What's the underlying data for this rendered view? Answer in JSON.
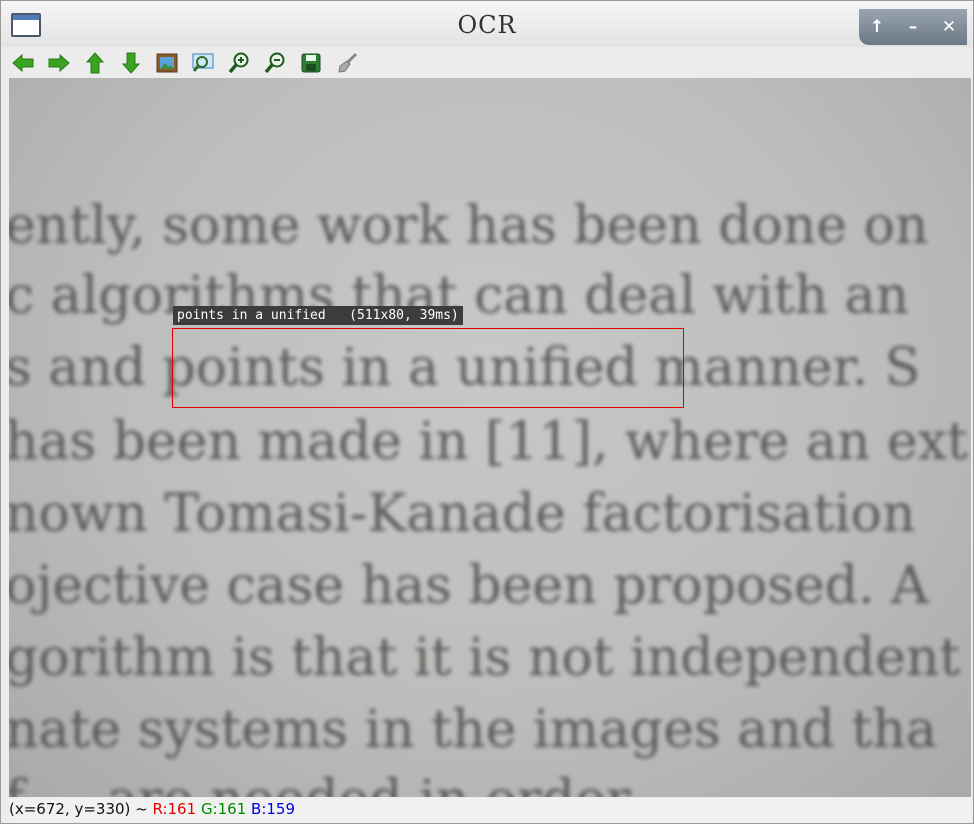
{
  "window": {
    "title": "OCR"
  },
  "wm": {
    "restore": "↑",
    "minimize": "–",
    "close": "✕"
  },
  "toolbar": {
    "buttons": [
      {
        "name": "pan-left-button",
        "icon": "arrow-left-icon",
        "color": "#3aa321"
      },
      {
        "name": "pan-right-button",
        "icon": "arrow-right-icon",
        "color": "#3aa321"
      },
      {
        "name": "pan-up-button",
        "icon": "arrow-up-icon",
        "color": "#3aa321"
      },
      {
        "name": "pan-down-button",
        "icon": "arrow-down-icon",
        "color": "#3aa321"
      },
      {
        "name": "zoom-fit-button",
        "icon": "image-icon",
        "color": "#3a7fbf"
      },
      {
        "name": "zoom-region-button",
        "icon": "zoom-region-icon",
        "color": "#3a7fbf"
      },
      {
        "name": "zoom-in-button",
        "icon": "zoom-in-icon",
        "color": "#2d6e2d"
      },
      {
        "name": "zoom-out-button",
        "icon": "zoom-out-icon",
        "color": "#2d6e2d"
      },
      {
        "name": "save-button",
        "icon": "save-icon",
        "color": "#2e7d32"
      },
      {
        "name": "properties-button",
        "icon": "brush-icon",
        "color": "#888888"
      }
    ]
  },
  "image": {
    "lines": [
      "ently, some work has been done on",
      "c algorithms that can deal with an",
      "s and points in a unified manner. S",
      " has been made in [11], where an ext",
      "nown Tomasi-Kanade factorisation ",
      "ojective case has been proposed. A",
      "gorithm is that it is not independent",
      "nate systems in the images and tha",
      "    f   ...  are needed in order"
    ],
    "detection": {
      "label": "points in a unified   (511x80, 39ms)",
      "color": "#e00000"
    }
  },
  "status": {
    "coords": "(x=672, y=330) ~ ",
    "r": "R:161",
    "g": "G:161",
    "b": "B:159",
    "colors": {
      "r": "#e00000",
      "g": "#008a00",
      "b": "#0000e0"
    }
  }
}
